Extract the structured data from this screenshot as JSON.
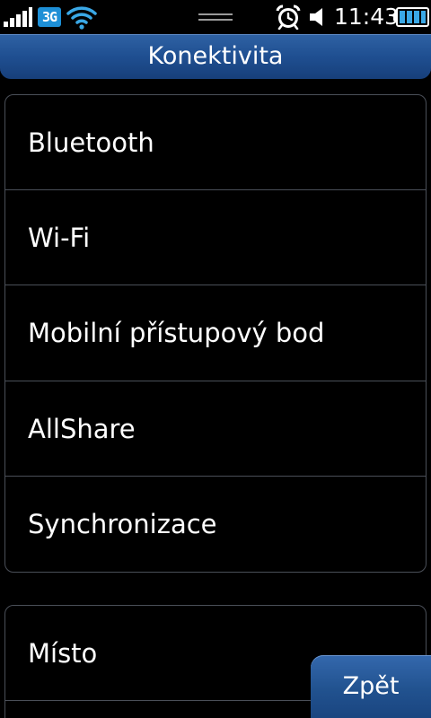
{
  "status_bar": {
    "network_type": "3G",
    "time": "11:43",
    "icons": [
      "signal-strength-icon",
      "3g-icon",
      "wifi-icon",
      "alarm-clock-icon",
      "speaker-icon",
      "battery-icon"
    ]
  },
  "header": {
    "title": "Konektivita"
  },
  "groups": [
    {
      "items": [
        {
          "label": "Bluetooth"
        },
        {
          "label": "Wi-Fi"
        },
        {
          "label": "Mobilní přístupový bod"
        },
        {
          "label": "AllShare"
        },
        {
          "label": "Synchronizace"
        }
      ]
    },
    {
      "items": [
        {
          "label": "Místo"
        }
      ]
    }
  ],
  "footer": {
    "back_label": "Zpět"
  },
  "colors": {
    "accent": "#1f4f91",
    "badge_3g": "#1d8fd6",
    "wifi": "#3aa8e6",
    "battery": "#3aa8e6",
    "divider": "#4a4f58"
  }
}
